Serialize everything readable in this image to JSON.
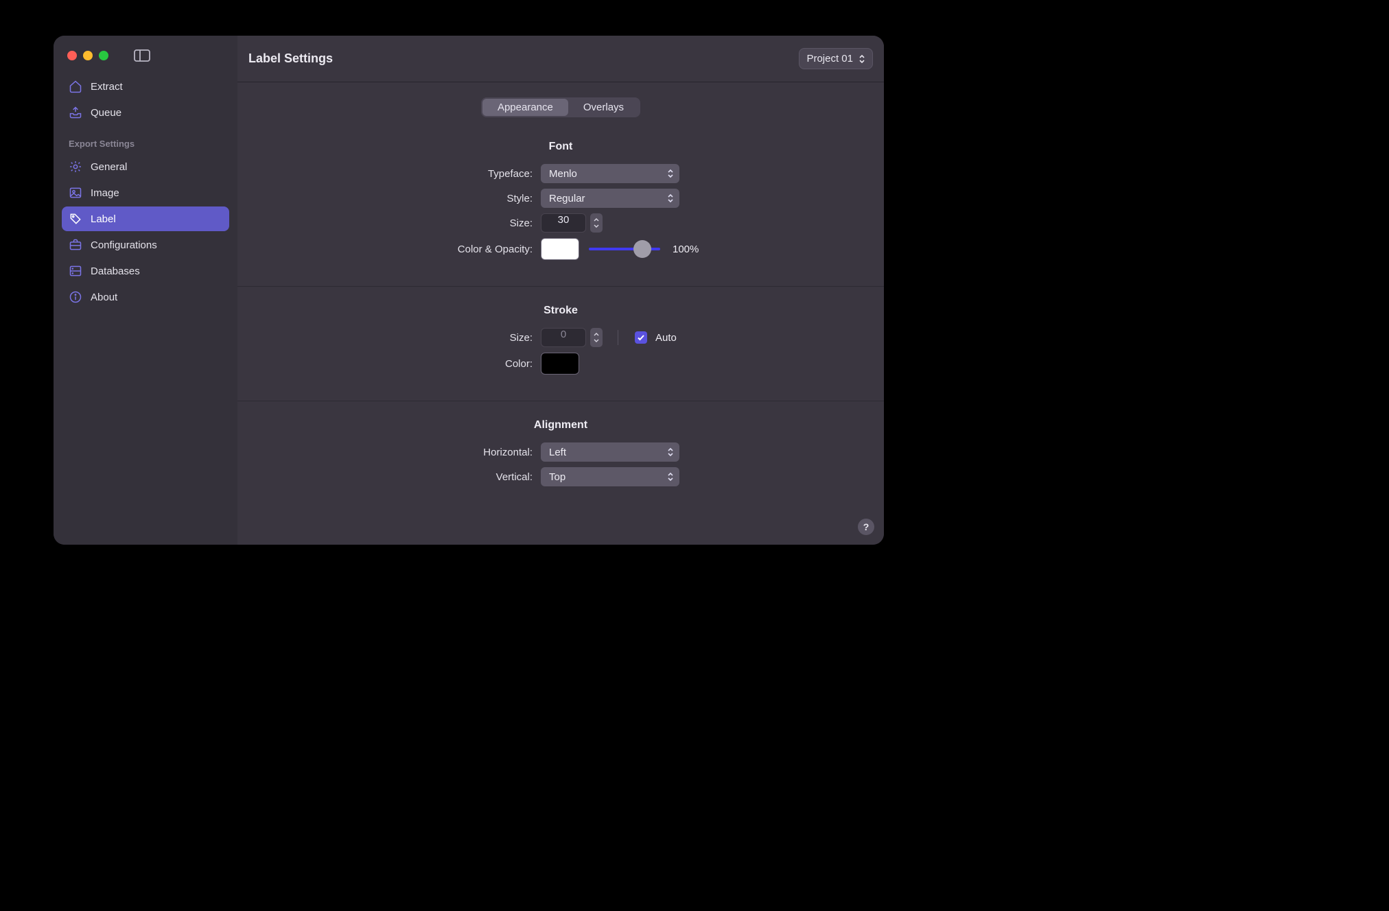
{
  "header": {
    "title": "Label Settings",
    "project": "Project 01"
  },
  "sidebar": {
    "top_items": [
      {
        "icon": "home",
        "label": "Extract"
      },
      {
        "icon": "tray",
        "label": "Queue"
      }
    ],
    "section_label": "Export Settings",
    "items": [
      {
        "icon": "gear",
        "label": "General",
        "selected": false
      },
      {
        "icon": "image",
        "label": "Image",
        "selected": false
      },
      {
        "icon": "tag",
        "label": "Label",
        "selected": true
      },
      {
        "icon": "briefcase",
        "label": "Configurations",
        "selected": false
      },
      {
        "icon": "database",
        "label": "Databases",
        "selected": false
      },
      {
        "icon": "info",
        "label": "About",
        "selected": false
      }
    ]
  },
  "tabs": {
    "items": [
      {
        "label": "Appearance",
        "active": true
      },
      {
        "label": "Overlays",
        "active": false
      }
    ]
  },
  "font": {
    "heading": "Font",
    "typeface_label": "Typeface:",
    "typeface_value": "Menlo",
    "style_label": "Style:",
    "style_value": "Regular",
    "size_label": "Size:",
    "size_value": "30",
    "color_opacity_label": "Color & Opacity:",
    "color_value": "#ffffff",
    "opacity_pct": "100%"
  },
  "stroke": {
    "heading": "Stroke",
    "size_label": "Size:",
    "size_value": "0",
    "auto_label": "Auto",
    "auto_checked": true,
    "color_label": "Color:",
    "color_value": "#000000"
  },
  "alignment": {
    "heading": "Alignment",
    "horizontal_label": "Horizontal:",
    "horizontal_value": "Left",
    "vertical_label": "Vertical:",
    "vertical_value": "Top"
  }
}
